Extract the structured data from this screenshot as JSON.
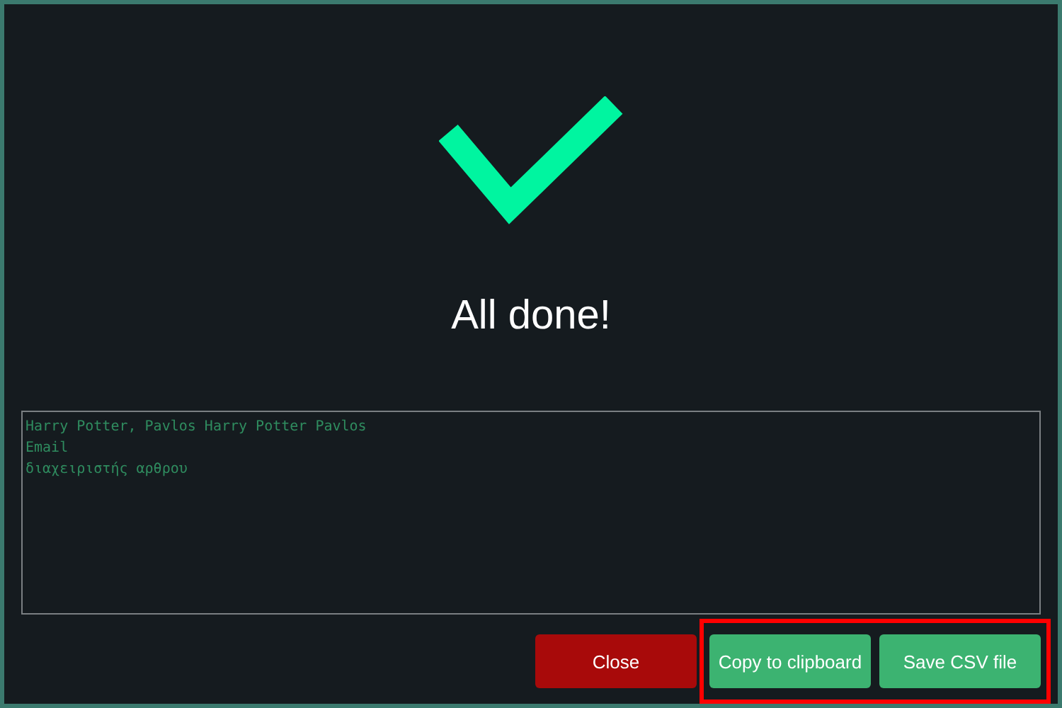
{
  "title": "All done!",
  "output": {
    "lines": [
      "Harry Potter, Pavlos Harry Potter Pavlos",
      "Email",
      "διαχειριστής αρθρου"
    ]
  },
  "button_groups": [
    {
      "highlighted": false,
      "buttons": [
        {
          "label": "Close",
          "kind": "danger"
        }
      ]
    },
    {
      "highlighted": true,
      "buttons": [
        {
          "label": "Copy to clipboard",
          "kind": "primary"
        },
        {
          "label": "Save CSV file",
          "kind": "primary"
        }
      ]
    }
  ]
}
